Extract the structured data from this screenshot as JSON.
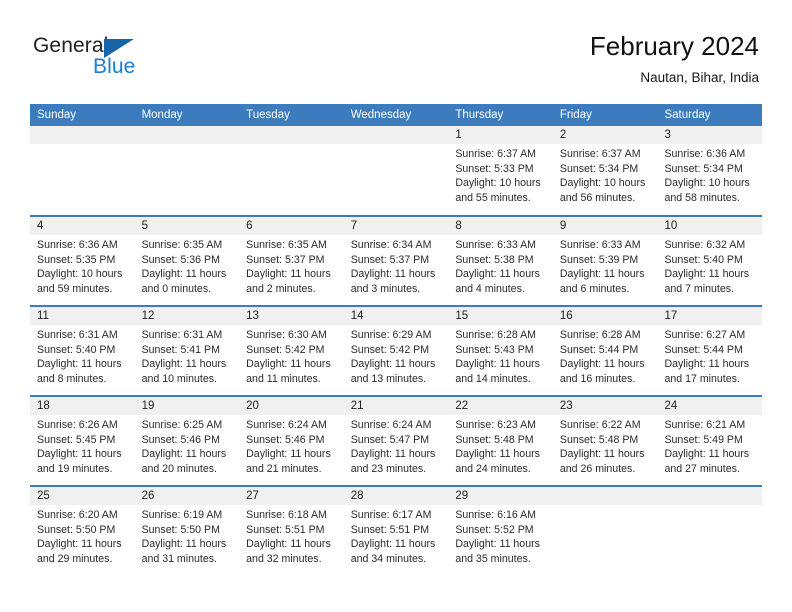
{
  "brand": {
    "name_part1": "General",
    "name_part2": "Blue",
    "triangle_color": "#1565a8",
    "blue_color": "#1b7fd4"
  },
  "header": {
    "title": "February 2024",
    "subtitle": "Nautan, Bihar, India"
  },
  "theme": {
    "header_blue": "#3a7cbe",
    "day_band_gray": "#f0f0f0"
  },
  "weekdays": [
    "Sunday",
    "Monday",
    "Tuesday",
    "Wednesday",
    "Thursday",
    "Friday",
    "Saturday"
  ],
  "weeks": [
    [
      {
        "day": "",
        "lines": []
      },
      {
        "day": "",
        "lines": []
      },
      {
        "day": "",
        "lines": []
      },
      {
        "day": "",
        "lines": []
      },
      {
        "day": "1",
        "lines": [
          "Sunrise: 6:37 AM",
          "Sunset: 5:33 PM",
          "Daylight: 10 hours",
          "and 55 minutes."
        ]
      },
      {
        "day": "2",
        "lines": [
          "Sunrise: 6:37 AM",
          "Sunset: 5:34 PM",
          "Daylight: 10 hours",
          "and 56 minutes."
        ]
      },
      {
        "day": "3",
        "lines": [
          "Sunrise: 6:36 AM",
          "Sunset: 5:34 PM",
          "Daylight: 10 hours",
          "and 58 minutes."
        ]
      }
    ],
    [
      {
        "day": "4",
        "lines": [
          "Sunrise: 6:36 AM",
          "Sunset: 5:35 PM",
          "Daylight: 10 hours",
          "and 59 minutes."
        ]
      },
      {
        "day": "5",
        "lines": [
          "Sunrise: 6:35 AM",
          "Sunset: 5:36 PM",
          "Daylight: 11 hours",
          "and 0 minutes."
        ]
      },
      {
        "day": "6",
        "lines": [
          "Sunrise: 6:35 AM",
          "Sunset: 5:37 PM",
          "Daylight: 11 hours",
          "and 2 minutes."
        ]
      },
      {
        "day": "7",
        "lines": [
          "Sunrise: 6:34 AM",
          "Sunset: 5:37 PM",
          "Daylight: 11 hours",
          "and 3 minutes."
        ]
      },
      {
        "day": "8",
        "lines": [
          "Sunrise: 6:33 AM",
          "Sunset: 5:38 PM",
          "Daylight: 11 hours",
          "and 4 minutes."
        ]
      },
      {
        "day": "9",
        "lines": [
          "Sunrise: 6:33 AM",
          "Sunset: 5:39 PM",
          "Daylight: 11 hours",
          "and 6 minutes."
        ]
      },
      {
        "day": "10",
        "lines": [
          "Sunrise: 6:32 AM",
          "Sunset: 5:40 PM",
          "Daylight: 11 hours",
          "and 7 minutes."
        ]
      }
    ],
    [
      {
        "day": "11",
        "lines": [
          "Sunrise: 6:31 AM",
          "Sunset: 5:40 PM",
          "Daylight: 11 hours",
          "and 8 minutes."
        ]
      },
      {
        "day": "12",
        "lines": [
          "Sunrise: 6:31 AM",
          "Sunset: 5:41 PM",
          "Daylight: 11 hours",
          "and 10 minutes."
        ]
      },
      {
        "day": "13",
        "lines": [
          "Sunrise: 6:30 AM",
          "Sunset: 5:42 PM",
          "Daylight: 11 hours",
          "and 11 minutes."
        ]
      },
      {
        "day": "14",
        "lines": [
          "Sunrise: 6:29 AM",
          "Sunset: 5:42 PM",
          "Daylight: 11 hours",
          "and 13 minutes."
        ]
      },
      {
        "day": "15",
        "lines": [
          "Sunrise: 6:28 AM",
          "Sunset: 5:43 PM",
          "Daylight: 11 hours",
          "and 14 minutes."
        ]
      },
      {
        "day": "16",
        "lines": [
          "Sunrise: 6:28 AM",
          "Sunset: 5:44 PM",
          "Daylight: 11 hours",
          "and 16 minutes."
        ]
      },
      {
        "day": "17",
        "lines": [
          "Sunrise: 6:27 AM",
          "Sunset: 5:44 PM",
          "Daylight: 11 hours",
          "and 17 minutes."
        ]
      }
    ],
    [
      {
        "day": "18",
        "lines": [
          "Sunrise: 6:26 AM",
          "Sunset: 5:45 PM",
          "Daylight: 11 hours",
          "and 19 minutes."
        ]
      },
      {
        "day": "19",
        "lines": [
          "Sunrise: 6:25 AM",
          "Sunset: 5:46 PM",
          "Daylight: 11 hours",
          "and 20 minutes."
        ]
      },
      {
        "day": "20",
        "lines": [
          "Sunrise: 6:24 AM",
          "Sunset: 5:46 PM",
          "Daylight: 11 hours",
          "and 21 minutes."
        ]
      },
      {
        "day": "21",
        "lines": [
          "Sunrise: 6:24 AM",
          "Sunset: 5:47 PM",
          "Daylight: 11 hours",
          "and 23 minutes."
        ]
      },
      {
        "day": "22",
        "lines": [
          "Sunrise: 6:23 AM",
          "Sunset: 5:48 PM",
          "Daylight: 11 hours",
          "and 24 minutes."
        ]
      },
      {
        "day": "23",
        "lines": [
          "Sunrise: 6:22 AM",
          "Sunset: 5:48 PM",
          "Daylight: 11 hours",
          "and 26 minutes."
        ]
      },
      {
        "day": "24",
        "lines": [
          "Sunrise: 6:21 AM",
          "Sunset: 5:49 PM",
          "Daylight: 11 hours",
          "and 27 minutes."
        ]
      }
    ],
    [
      {
        "day": "25",
        "lines": [
          "Sunrise: 6:20 AM",
          "Sunset: 5:50 PM",
          "Daylight: 11 hours",
          "and 29 minutes."
        ]
      },
      {
        "day": "26",
        "lines": [
          "Sunrise: 6:19 AM",
          "Sunset: 5:50 PM",
          "Daylight: 11 hours",
          "and 31 minutes."
        ]
      },
      {
        "day": "27",
        "lines": [
          "Sunrise: 6:18 AM",
          "Sunset: 5:51 PM",
          "Daylight: 11 hours",
          "and 32 minutes."
        ]
      },
      {
        "day": "28",
        "lines": [
          "Sunrise: 6:17 AM",
          "Sunset: 5:51 PM",
          "Daylight: 11 hours",
          "and 34 minutes."
        ]
      },
      {
        "day": "29",
        "lines": [
          "Sunrise: 6:16 AM",
          "Sunset: 5:52 PM",
          "Daylight: 11 hours",
          "and 35 minutes."
        ]
      },
      {
        "day": "",
        "lines": []
      },
      {
        "day": "",
        "lines": []
      }
    ]
  ]
}
